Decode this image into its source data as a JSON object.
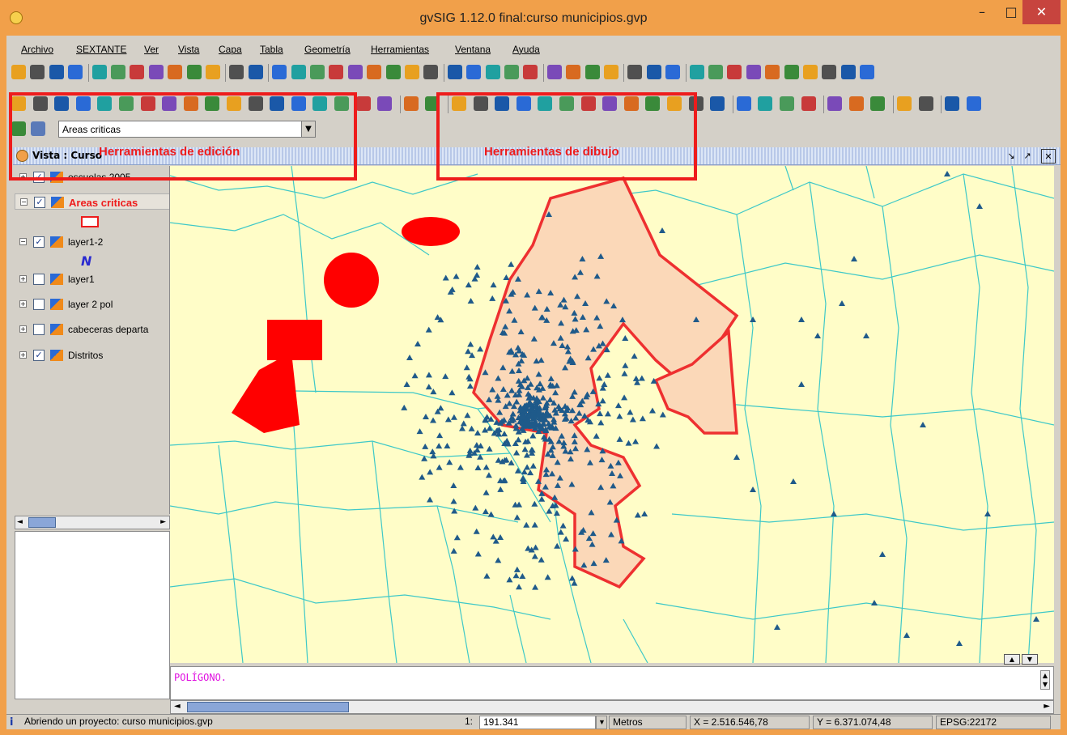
{
  "window": {
    "title": "gvSIG 1.12.0 final:curso municipios.gvp",
    "min_icon": "minimize-icon",
    "max_icon": "maximize-icon",
    "close_icon": "close-icon"
  },
  "menu": [
    {
      "label": "Archivo"
    },
    {
      "label": "SEXTANTE"
    },
    {
      "label": "Ver"
    },
    {
      "label": "Vista"
    },
    {
      "label": "Capa"
    },
    {
      "label": "Tabla"
    },
    {
      "label": "Geometría"
    },
    {
      "label": "Herramientas"
    },
    {
      "label": "Ventana"
    },
    {
      "label": "Ayuda"
    }
  ],
  "layer_selector": {
    "selected": "Areas criticas"
  },
  "view": {
    "title": "Vista : Curso"
  },
  "annotations": {
    "edit_tools": "Herramientas de edición",
    "draw_tools": "Herramientas de dibujo"
  },
  "toc": {
    "layers": [
      {
        "name": "escuelas 2005",
        "checked": true,
        "expanded": false
      },
      {
        "name": "Areas criticas",
        "checked": true,
        "expanded": true,
        "active": true
      },
      {
        "name": "layer1-2",
        "checked": true,
        "expanded": true
      },
      {
        "name": "layer1",
        "checked": false,
        "expanded": false
      },
      {
        "name": "layer 2 pol",
        "checked": false,
        "expanded": false
      },
      {
        "name": "cabeceras departa",
        "checked": false,
        "expanded": false
      },
      {
        "name": "Distritos",
        "checked": true,
        "expanded": false
      }
    ]
  },
  "console": {
    "text": "POLÍGONO."
  },
  "status": {
    "message": "Abriendo un proyecto: curso municipios.gvp",
    "scale_label": "1:",
    "scale_value": "191.341",
    "units": "Metros",
    "x": "X = 2.516.546,78",
    "y": "Y = 6.371.074,48",
    "crs": "EPSG:22172"
  },
  "colors": {
    "title_bar": "#f1a04a",
    "close_button": "#c7443e",
    "map_background": "#fffdc8",
    "boundaries": "#3ec8c8",
    "critical_area_fill": "#fbd8b8",
    "critical_area_stroke": "#ee3030",
    "drawn_shapes": "#ff0000",
    "points": "#1f5a8a",
    "annotation": "#ee1c1c",
    "console_text": "#e010e0"
  }
}
